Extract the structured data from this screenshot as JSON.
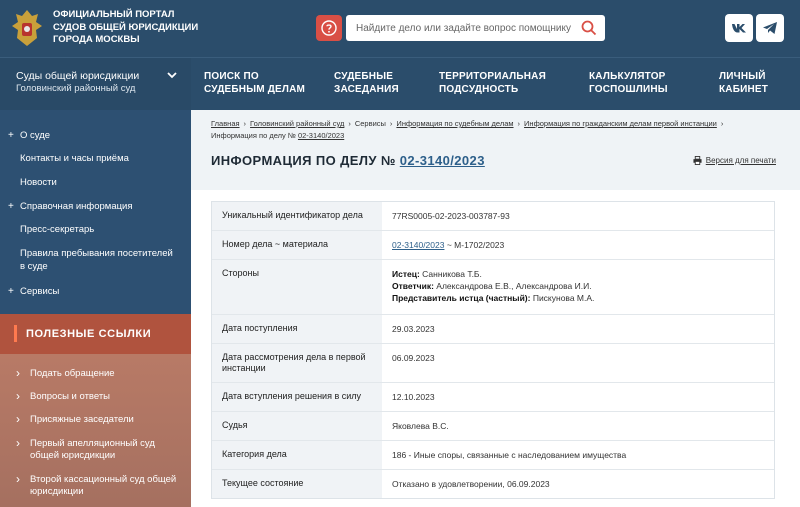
{
  "header": {
    "portal_title": [
      "ОФИЦИАЛЬНЫЙ ПОРТАЛ",
      "СУДОВ ОБЩЕЙ ЮРИСДИКЦИИ",
      "ГОРОДА МОСКВЫ"
    ],
    "search_placeholder": "Найдите дело или задайте вопрос помощнику",
    "social": [
      "vk-icon",
      "telegram-icon"
    ]
  },
  "court_select": {
    "line1": "Суды общей юрисдикции",
    "line2": "Головинский районный суд"
  },
  "topnav": [
    {
      "l1": "Поиск по",
      "l2": "судебным делам"
    },
    {
      "l1": "Судебные",
      "l2": "заседания"
    },
    {
      "l1": "Территориальная",
      "l2": "подсудность"
    },
    {
      "l1": "Калькулятор",
      "l2": "госпошлины"
    },
    {
      "l1": "Личный",
      "l2": "кабинет"
    }
  ],
  "sidebar": {
    "items": [
      "О суде",
      "Контакты и часы приёма",
      "Новости",
      "Справочная информация",
      "Пресс-секретарь",
      "Правила пребывания посетителей в суде",
      "Сервисы"
    ],
    "links_title": "Полезные ссылки",
    "links": [
      "Подать обращение",
      "Вопросы и ответы",
      "Присяжные заседатели",
      "Первый апелляционный суд общей юрисдикции",
      "Второй кассационный суд общей юрисдикции"
    ]
  },
  "breadcrumb": {
    "items": [
      "Главная",
      "Головинский районный суд",
      "Сервисы",
      "Информация по судебным делам",
      "Информация по гражданским делам первой инстанции"
    ],
    "current_prefix": "Информация по делу №",
    "current_number": "02-3140/2023"
  },
  "page": {
    "title_prefix": "Информация по делу №",
    "case_number": "02-3140/2023",
    "print_label": "Версия для печати"
  },
  "table": {
    "uid_label": "Уникальный идентификатор дела",
    "uid_value": "77RS0005-02-2023-003787-93",
    "num_label": "Номер дела ~ материала",
    "num_link": "02-3140/2023",
    "num_rest": "~ М-1702/2023",
    "parties_label": "Стороны",
    "plaintiff_role": "Истец:",
    "plaintiff": "Санникова Т.Б.",
    "defendant_role": "Ответчик:",
    "defendant": "Александрова Е.В., Александрова И.И.",
    "rep_role": "Представитель истца (частный):",
    "rep": "Пискунова М.А.",
    "received_label": "Дата поступления",
    "received_value": "29.03.2023",
    "review_label": "Дата рассмотрения дела в первой инстанции",
    "review_value": "06.09.2023",
    "effect_label": "Дата вступления решения в силу",
    "effect_value": "12.10.2023",
    "judge_label": "Судья",
    "judge_value": "Яковлева В.С.",
    "category_label": "Категория дела",
    "category_value": "186 - Иные споры, связанные с наследованием имущества",
    "state_label": "Текущее состояние",
    "state_value": "Отказано в удовлетворении, 06.09.2023"
  },
  "colors": {
    "header_bg": "#2b4d6b",
    "accent_red": "#d94f45",
    "links_head": "#b0533e",
    "link_blue": "#2d5f8a"
  }
}
